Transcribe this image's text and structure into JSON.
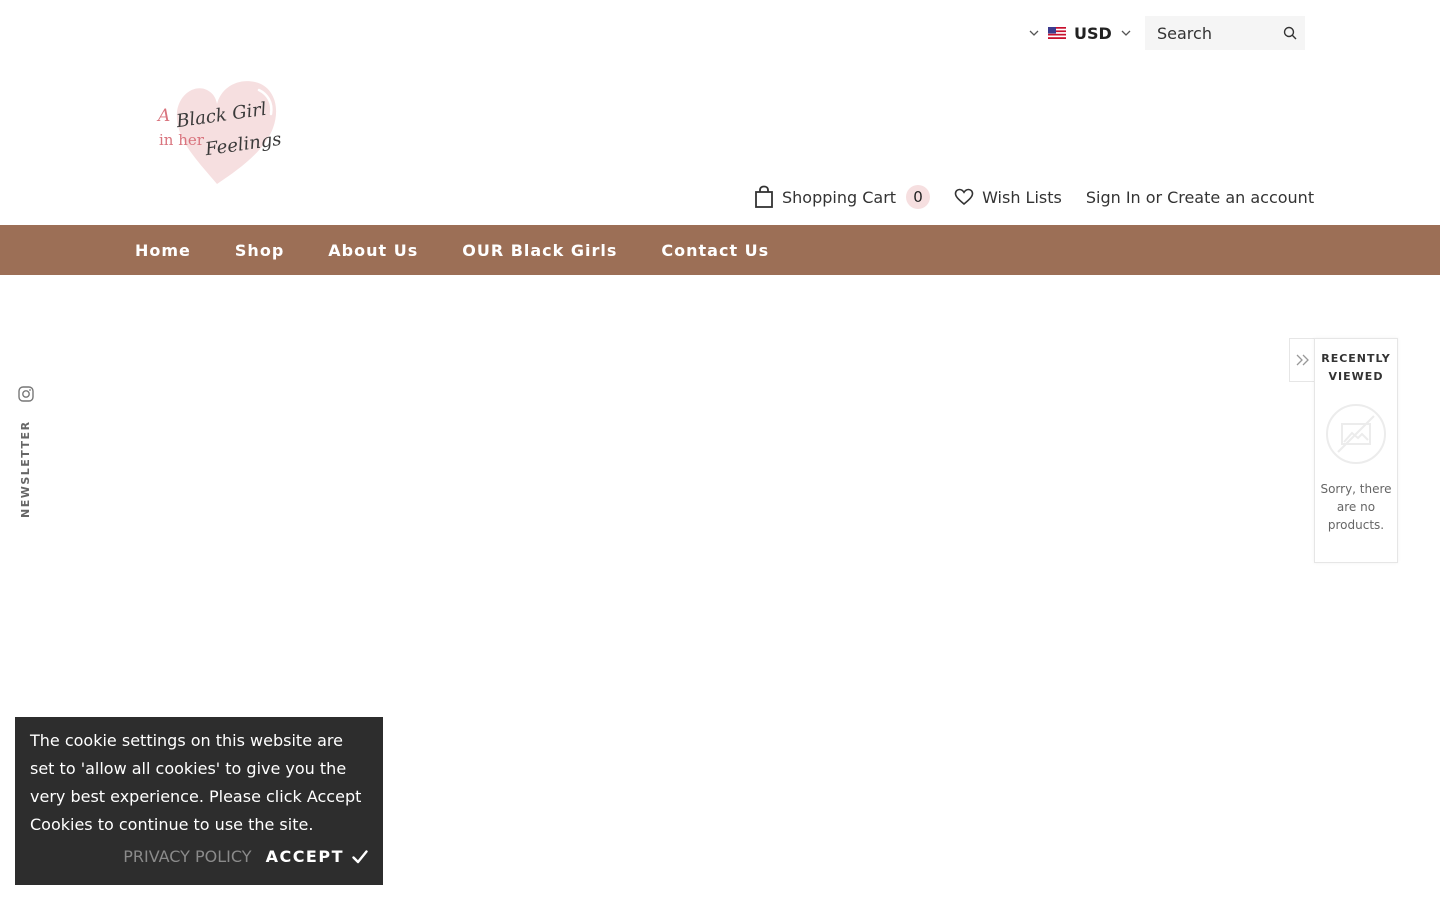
{
  "header": {
    "currency": {
      "code": "USD",
      "flag_icon": "us-flag-icon"
    },
    "search": {
      "placeholder": "Search"
    },
    "logo": {
      "line1_prefix": "A",
      "line1_script": "Black Girl",
      "line2_prefix": "in her",
      "line2_script": "Feelings",
      "heart_color": "#f6dfe0"
    },
    "cart": {
      "label": "Shopping Cart",
      "count": "0"
    },
    "wishlist": {
      "label": "Wish Lists"
    },
    "auth": {
      "sign_in": "Sign In",
      "separator": "or",
      "create": "Create an account"
    }
  },
  "nav": {
    "background": "#9c6f56",
    "items": [
      {
        "label": "Home"
      },
      {
        "label": "Shop"
      },
      {
        "label": "About Us"
      },
      {
        "label": "OUR Black Girls"
      },
      {
        "label": "Contact Us"
      }
    ]
  },
  "side": {
    "social_icon": "instagram-icon",
    "newsletter_label": "NEWSLETTER"
  },
  "recently_viewed": {
    "title_line1": "RECENTLY",
    "title_line2": "VIEWED",
    "empty_message": "Sorry, there are no products."
  },
  "cookie": {
    "message": "The cookie settings on this website are set to 'allow all cookies' to give you the very best experience. Please click Accept Cookies to continue to use the site.",
    "privacy_label": "PRIVACY POLICY",
    "accept_label": "ACCEPT",
    "accept_icon": "checkmark-icon"
  }
}
